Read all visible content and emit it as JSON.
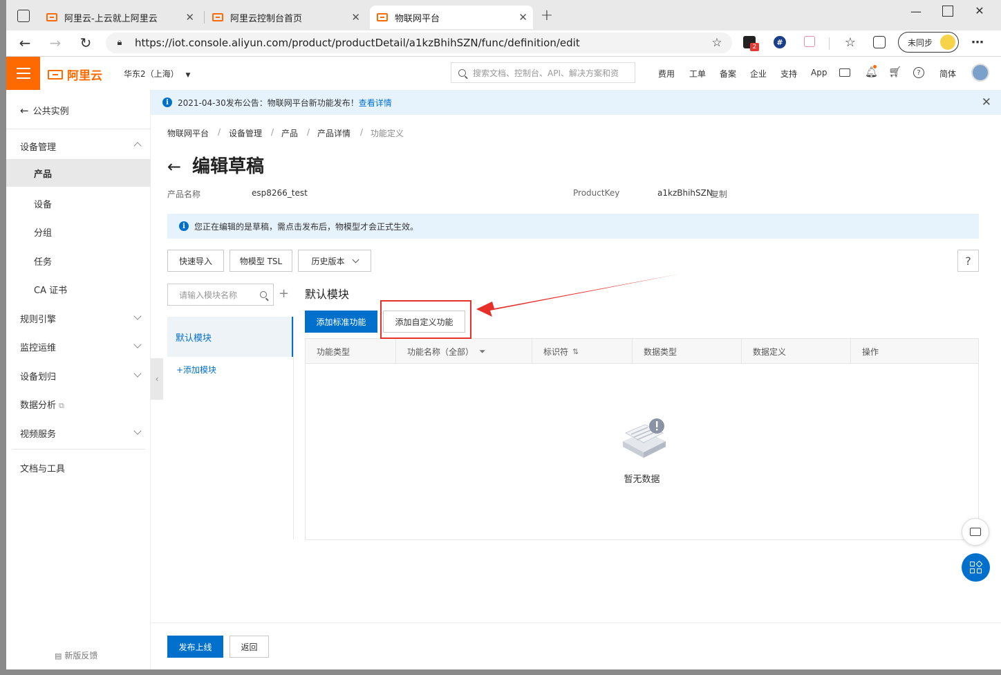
{
  "browser": {
    "tabs": [
      {
        "title": "阿里云-上云就上阿里云"
      },
      {
        "title": "阿里云控制台首页"
      },
      {
        "title": "物联网平台"
      }
    ],
    "url": "https://iot.console.aliyun.com/product/productDetail/a1kzBhihSZN/func/definition/edit",
    "sync_label": "未同步",
    "badge_count": "2"
  },
  "header": {
    "brand": "阿里云",
    "region": "华东2（上海）",
    "search_placeholder": "搜索文档、控制台、API、解决方案和资",
    "nav": [
      "费用",
      "工单",
      "备案",
      "企业",
      "支持",
      "App"
    ],
    "lang": "简体"
  },
  "sidebar": {
    "back": "公共实例",
    "group_device": "设备管理",
    "items": [
      {
        "label": "产品",
        "selected": true
      },
      {
        "label": "设备"
      },
      {
        "label": "分组"
      },
      {
        "label": "任务"
      },
      {
        "label": "CA 证书"
      }
    ],
    "sections": [
      "规则引擎",
      "监控运维",
      "设备划归",
      "数据分析",
      "视频服务"
    ],
    "docs": "文档与工具",
    "feedback": "新版反馈"
  },
  "announcement": {
    "text": "2021-04-30发布公告：物联网平台新功能发布！",
    "link": "查看详情"
  },
  "breadcrumb": [
    "物联网平台",
    "设备管理",
    "产品",
    "产品详情",
    "功能定义"
  ],
  "page": {
    "title": "编辑草稿",
    "product_name_label": "产品名称",
    "product_name": "esp8266_test",
    "productkey_label": "ProductKey",
    "productkey": "a1kzBhihSZN",
    "copy": "复制",
    "notice": "您正在编辑的是草稿，需点击发布后，物模型才会正式生效。"
  },
  "toolbar": {
    "quick_import": "快速导入",
    "tsl": "物模型 TSL",
    "history": "历史版本"
  },
  "modules": {
    "search_placeholder": "请输入模块名称",
    "default": "默认模块",
    "add": "+添加模块"
  },
  "function_panel": {
    "title": "默认模块",
    "add_standard": "添加标准功能",
    "add_custom": "添加自定义功能",
    "columns": [
      "功能类型",
      "功能名称（全部）",
      "标识符",
      "数据类型",
      "数据定义",
      "操作"
    ],
    "empty": "暂无数据"
  },
  "footer": {
    "publish": "发布上线",
    "back": "返回"
  },
  "colors": {
    "brand_orange": "#ff6a00",
    "primary_blue": "#0070cc",
    "highlight_red": "#e8302b"
  }
}
